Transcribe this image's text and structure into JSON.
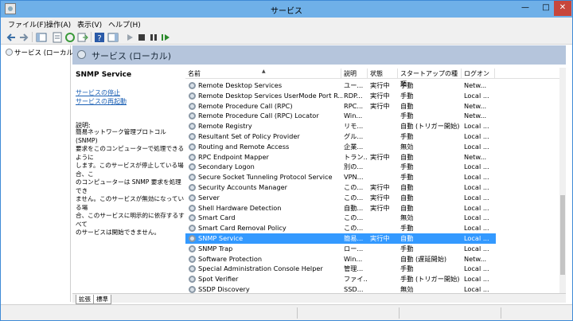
{
  "window": {
    "title": "サービス"
  },
  "titlebar": {
    "minimize": "—",
    "maximize": "□",
    "close": "✕"
  },
  "menu": [
    "ファイル(F)",
    "操作(A)",
    "表示(V)",
    "ヘルプ(H)"
  ],
  "tree": {
    "root": "サービス (ローカル)"
  },
  "panel": {
    "header": "サービス (ローカル)"
  },
  "description_pane": {
    "service_name": "SNMP Service",
    "stop_link": "サービスの停止",
    "restart_link": "サービスの再起動",
    "description_label": "説明:",
    "description_text": "簡易ネットワーク管理プロトコル (SNMP)\n要求をこのコンピューターで処理できるように\nします。このサービスが停止している場合、こ\nのコンピューターは SNMP 要求を処理でき\nません。このサービスが無効になっている場\n合、このサービスに明示的に依存するすべて\nのサービスは開始できません。"
  },
  "columns": {
    "name": "名前",
    "description": "説明",
    "status": "状態",
    "startup": "スタートアップの種類",
    "logon": "ログオン"
  },
  "rows": [
    {
      "name": "Remote Desktop Services",
      "desc": "ユー...",
      "status": "実行中",
      "startup": "手動",
      "logon": "Netw..."
    },
    {
      "name": "Remote Desktop Services UserMode Port R...",
      "desc": "RDP...",
      "status": "実行中",
      "startup": "手動",
      "logon": "Local ..."
    },
    {
      "name": "Remote Procedure Call (RPC)",
      "desc": "RPC...",
      "status": "実行中",
      "startup": "自動",
      "logon": "Netw..."
    },
    {
      "name": "Remote Procedure Call (RPC) Locator",
      "desc": "Win...",
      "status": "",
      "startup": "手動",
      "logon": "Netw..."
    },
    {
      "name": "Remote Registry",
      "desc": "リモ...",
      "status": "",
      "startup": "自動 (トリガー開始)",
      "logon": "Local ..."
    },
    {
      "name": "Resultant Set of Policy Provider",
      "desc": "グル...",
      "status": "",
      "startup": "手動",
      "logon": "Local ..."
    },
    {
      "name": "Routing and Remote Access",
      "desc": "企業...",
      "status": "",
      "startup": "無効",
      "logon": "Local ..."
    },
    {
      "name": "RPC Endpoint Mapper",
      "desc": "トラン...",
      "status": "実行中",
      "startup": "自動",
      "logon": "Netw..."
    },
    {
      "name": "Secondary Logon",
      "desc": "別の...",
      "status": "",
      "startup": "手動",
      "logon": "Local ..."
    },
    {
      "name": "Secure Socket Tunneling Protocol Service",
      "desc": "VPN...",
      "status": "",
      "startup": "手動",
      "logon": "Local ..."
    },
    {
      "name": "Security Accounts Manager",
      "desc": "この...",
      "status": "実行中",
      "startup": "自動",
      "logon": "Local ..."
    },
    {
      "name": "Server",
      "desc": "この...",
      "status": "実行中",
      "startup": "自動",
      "logon": "Local ..."
    },
    {
      "name": "Shell Hardware Detection",
      "desc": "自動...",
      "status": "実行中",
      "startup": "自動",
      "logon": "Local ..."
    },
    {
      "name": "Smart Card",
      "desc": "この...",
      "status": "",
      "startup": "無効",
      "logon": "Local ..."
    },
    {
      "name": "Smart Card Removal Policy",
      "desc": "この...",
      "status": "",
      "startup": "手動",
      "logon": "Local ..."
    },
    {
      "name": "SNMP Service",
      "desc": "簡易...",
      "status": "実行中",
      "startup": "自動",
      "logon": "Local ...",
      "selected": true
    },
    {
      "name": "SNMP Trap",
      "desc": "ロー...",
      "status": "",
      "startup": "手動",
      "logon": "Local ..."
    },
    {
      "name": "Software Protection",
      "desc": "Win...",
      "status": "",
      "startup": "自動 (遅延開始)",
      "logon": "Netw..."
    },
    {
      "name": "Special Administration Console Helper",
      "desc": "管理...",
      "status": "",
      "startup": "手動",
      "logon": "Local ..."
    },
    {
      "name": "Spot Verifier",
      "desc": "ファイ...",
      "status": "",
      "startup": "手動 (トリガー開始)",
      "logon": "Local ..."
    },
    {
      "name": "SSDP Discovery",
      "desc": "SSD...",
      "status": "",
      "startup": "無効",
      "logon": "Local ..."
    }
  ],
  "tabs": {
    "extended": "拡張",
    "standard": "標準"
  },
  "colors": {
    "selection": "#3399ff",
    "titlebar": "#6fb0e8",
    "panel_header": "#b5c5dc",
    "link": "#1a5fb4"
  }
}
